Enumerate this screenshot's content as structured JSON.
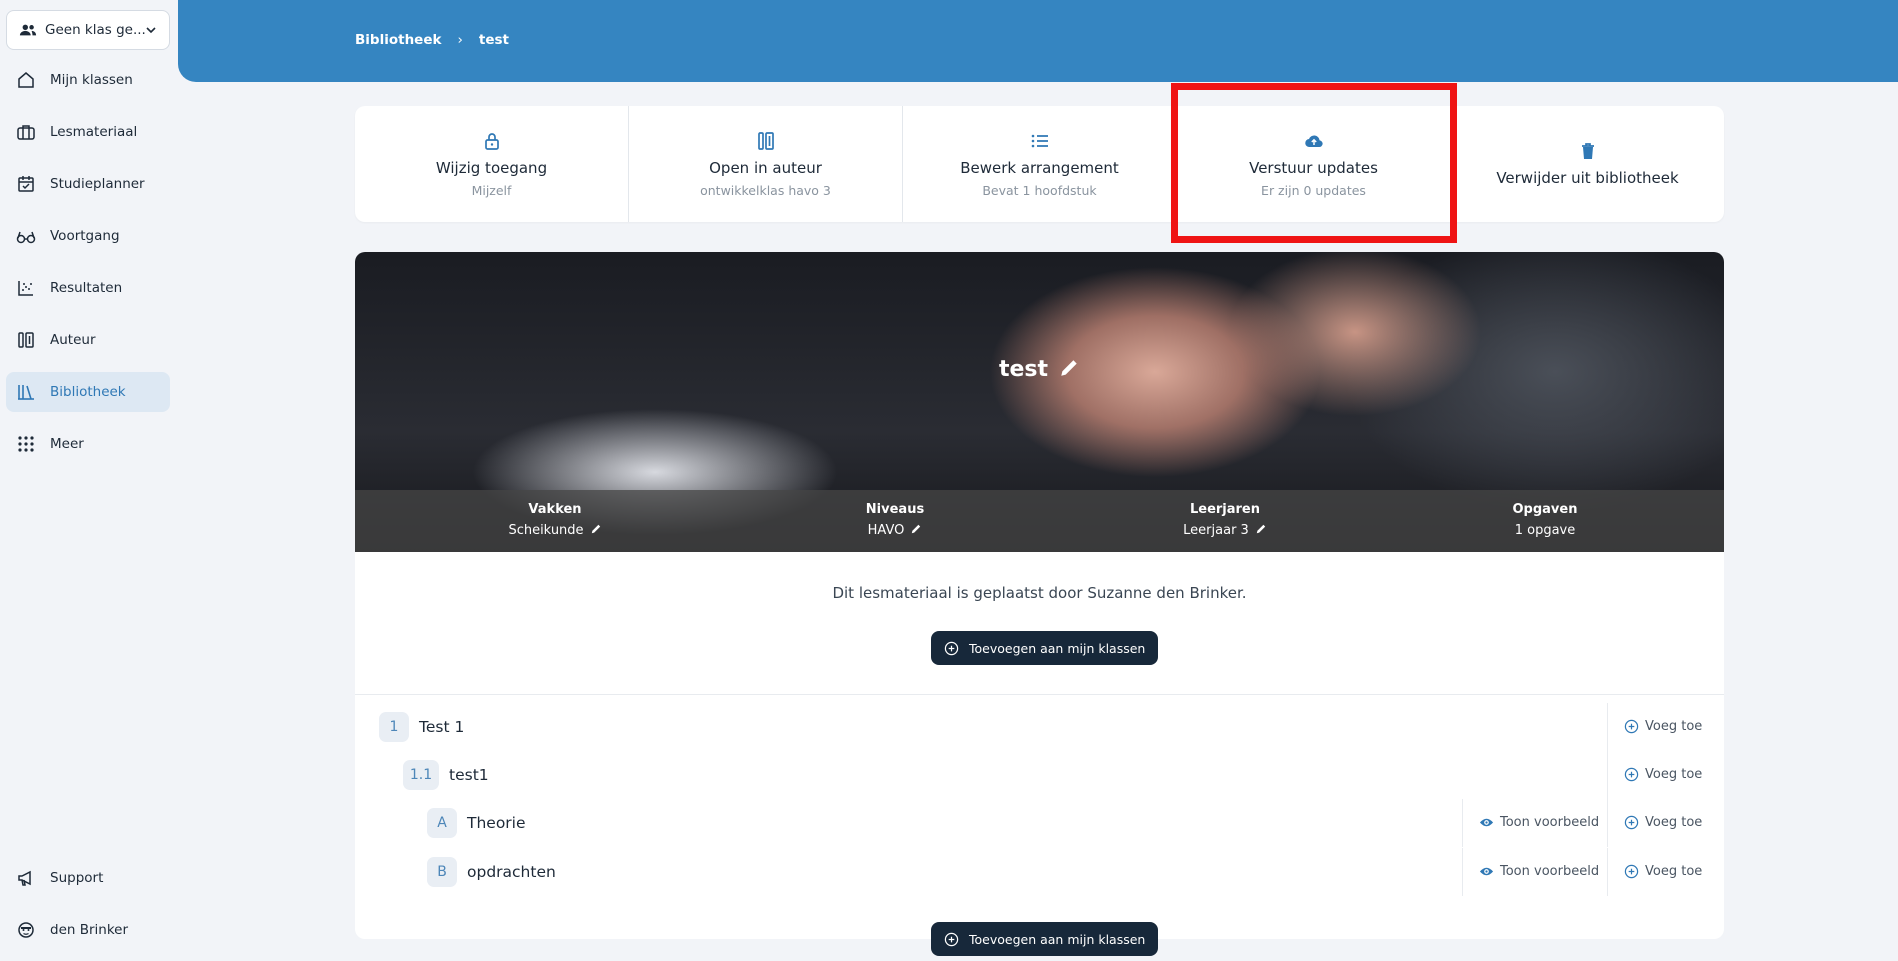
{
  "sidebar": {
    "class_selector": "Geen klas ge...",
    "items": [
      {
        "label": "Mijn klassen",
        "icon": "home-icon"
      },
      {
        "label": "Lesmateriaal",
        "icon": "briefcase-icon"
      },
      {
        "label": "Studieplanner",
        "icon": "calendar-check-icon"
      },
      {
        "label": "Voortgang",
        "icon": "glasses-icon"
      },
      {
        "label": "Resultaten",
        "icon": "scatter-chart-icon"
      },
      {
        "label": "Auteur",
        "icon": "author-tools-icon"
      },
      {
        "label": "Bibliotheek",
        "icon": "library-icon",
        "active": true
      },
      {
        "label": "Meer",
        "icon": "grid-icon"
      }
    ],
    "bottom": [
      {
        "label": "Support",
        "icon": "megaphone-icon"
      },
      {
        "label": "den Brinker",
        "icon": "user-avatar-icon"
      }
    ]
  },
  "breadcrumb": {
    "root": "Bibliotheek",
    "separator": "›",
    "current": "test"
  },
  "actions": [
    {
      "title": "Wijzig toegang",
      "sub": "Mijzelf",
      "icon": "lock-icon"
    },
    {
      "title": "Open in auteur",
      "sub": "ontwikkelklas havo 3",
      "icon": "author-tools-icon"
    },
    {
      "title": "Bewerk arrangement",
      "sub": "Bevat 1 hoofdstuk",
      "icon": "list-icon"
    },
    {
      "title": "Verstuur updates",
      "sub": "Er zijn 0 updates",
      "icon": "cloud-upload-icon"
    },
    {
      "title": "Verwijder uit bibliotheek",
      "sub": "",
      "icon": "trash-icon"
    }
  ],
  "hero": {
    "title": "test",
    "meta": [
      {
        "label": "Vakken",
        "value": "Scheikunde",
        "editable": true
      },
      {
        "label": "Niveaus",
        "value": "HAVO",
        "editable": true
      },
      {
        "label": "Leerjaren",
        "value": "Leerjaar 3",
        "editable": true
      },
      {
        "label": "Opgaven",
        "value": "1 opgave",
        "editable": false
      }
    ]
  },
  "placed_by": "Dit lesmateriaal is geplaatst door Suzanne den Brinker.",
  "add_button": "Toevoegen aan mijn klassen",
  "outline": [
    {
      "num": "1",
      "label": "Test 1",
      "add": "Voeg toe"
    },
    {
      "num": "1.1",
      "label": "test1",
      "add": "Voeg toe"
    },
    {
      "num": "A",
      "label": "Theorie",
      "preview": "Toon voorbeeld",
      "add": "Voeg toe"
    },
    {
      "num": "B",
      "label": "opdrachten",
      "preview": "Toon voorbeeld",
      "add": "Voeg toe"
    }
  ],
  "colors": {
    "primary": "#3585c1",
    "dark_button": "#17283a",
    "highlight": "#ef1414"
  }
}
